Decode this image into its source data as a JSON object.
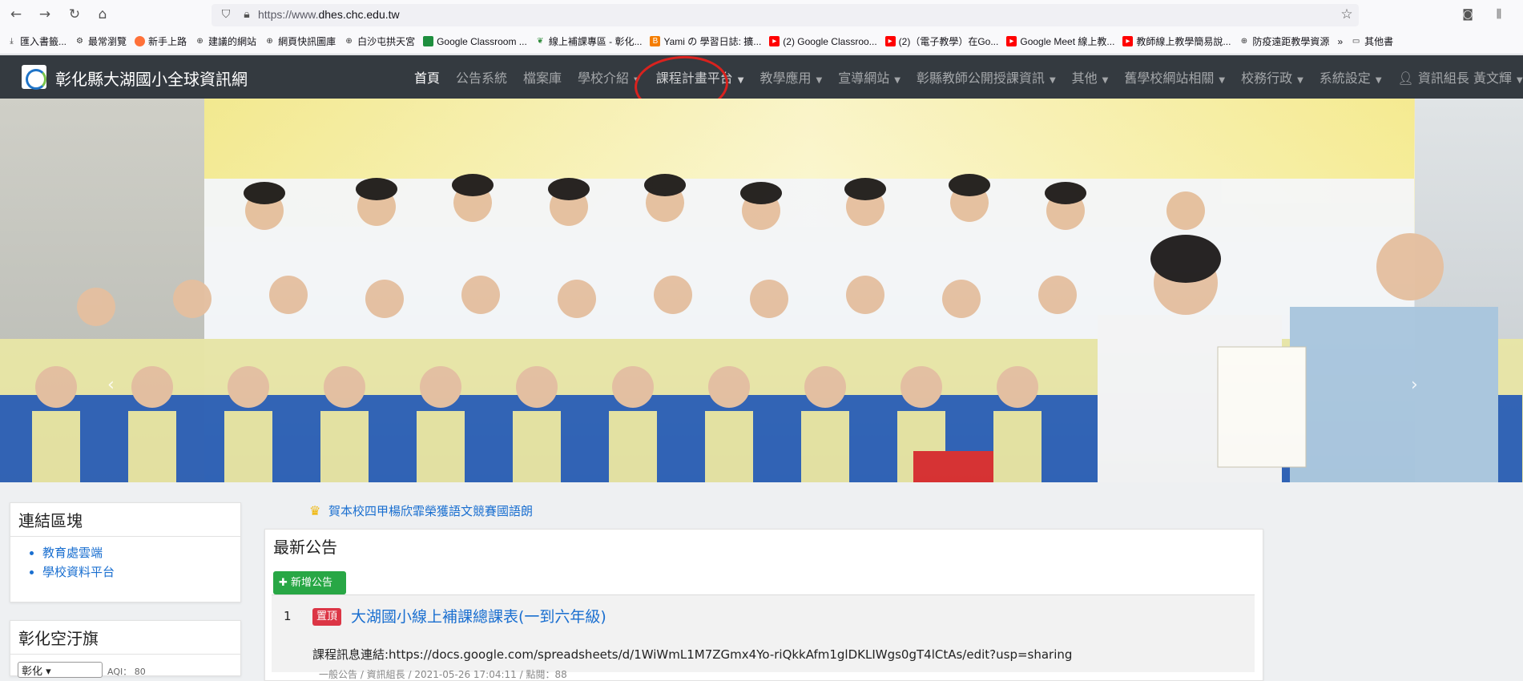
{
  "browser": {
    "url_prefix": "https://www.",
    "url_domain": "dhes.chc.edu.tw",
    "bookmarks": [
      {
        "label": "匯入書籤...",
        "icon": "import-icon"
      },
      {
        "label": "最常瀏覽",
        "icon": "gear-icon"
      },
      {
        "label": "新手上路",
        "icon": "firefox-icon"
      },
      {
        "label": "建議的網站",
        "icon": "globe-icon"
      },
      {
        "label": "網頁快訊圖庫",
        "icon": "globe-icon"
      },
      {
        "label": "白沙屯拱天宮",
        "icon": "globe-icon"
      },
      {
        "label": "Google Classroom ...",
        "icon": "classroom-icon"
      },
      {
        "label": "線上補課專區 - 彰化...",
        "icon": "leaf-icon"
      },
      {
        "label": "Yami の 學習日誌: 擴...",
        "icon": "blogger-icon"
      },
      {
        "label": "(2) Google Classroo...",
        "icon": "youtube-icon"
      },
      {
        "label": "(2)（電子教學）在Go...",
        "icon": "youtube-icon"
      },
      {
        "label": "Google Meet 線上教...",
        "icon": "youtube-icon"
      },
      {
        "label": "教師線上教學簡易說...",
        "icon": "youtube-icon"
      },
      {
        "label": "防疫遠距教學資源",
        "icon": "globe-icon"
      },
      {
        "label": "其他書",
        "icon": "folder-icon"
      }
    ]
  },
  "site": {
    "brand": "彰化縣大湖國小全球資訊網",
    "menu": [
      {
        "label": "首頁",
        "active": true,
        "dropdown": false
      },
      {
        "label": "公告系統",
        "active": false,
        "dropdown": false
      },
      {
        "label": "檔案庫",
        "active": false,
        "dropdown": false
      },
      {
        "label": "學校介紹",
        "active": false,
        "dropdown": true
      },
      {
        "label": "課程計畫平台",
        "active": false,
        "dropdown": true
      },
      {
        "label": "教學應用",
        "active": false,
        "dropdown": true
      },
      {
        "label": "宣導網站",
        "active": false,
        "dropdown": true
      },
      {
        "label": "彰縣教師公開授課資訊",
        "active": false,
        "dropdown": true
      },
      {
        "label": "其他",
        "active": false,
        "dropdown": true
      },
      {
        "label": "舊學校網站相關",
        "active": false,
        "dropdown": true
      },
      {
        "label": "校務行政",
        "active": false,
        "dropdown": true
      },
      {
        "label": "系統設定",
        "active": false,
        "dropdown": true
      },
      {
        "label": "資訊組長 黃文輝",
        "active": false,
        "dropdown": true,
        "icon": "user-icon"
      }
    ]
  },
  "hero": {
    "slide_count": 12,
    "active_slide": 1
  },
  "sidebar": {
    "links_title": "連結區塊",
    "links": [
      "教育處雲端",
      "學校資料平台"
    ],
    "air_title": "彰化空汙旗",
    "air_select": "彰化",
    "air_note": "AQI： 80"
  },
  "main": {
    "news_ticker": "賀本校四甲楊欣霏榮獲語文競賽國語朗",
    "section_title": "最新公告",
    "add_button": "新增公告",
    "announcements": [
      {
        "num": "1",
        "badge": "置頂",
        "title": "大湖國小線上補課總課表(一到六年級)",
        "body": "課程訊息連結:https://docs.google.com/spreadsheets/d/1WiWmL1M7ZGmx4Yo-riQkkAfm1glDKLIWgs0gT4lCtAs/edit?usp=sharing",
        "meta": "一般公告 / 資訊組長 / 2021-05-26 17:04:11 / 點閱：88"
      }
    ]
  },
  "colors": {
    "navbar": "#343a40",
    "link": "#1a6fd0",
    "badge": "#dc3545",
    "add_button": "#28a745",
    "highlight_circle": "#d9221e"
  }
}
